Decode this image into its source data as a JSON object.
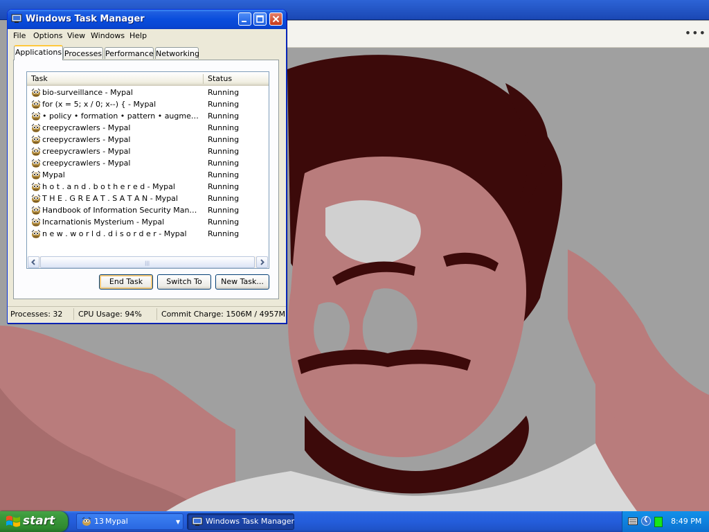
{
  "window": {
    "title": "Windows Task Manager",
    "icon": "task-manager-icon"
  },
  "menu": [
    "File",
    "Options",
    "View",
    "Windows",
    "Help"
  ],
  "tabs": [
    {
      "label": "Applications",
      "active": true
    },
    {
      "label": "Processes",
      "active": false
    },
    {
      "label": "Performance",
      "active": false
    },
    {
      "label": "Networking",
      "active": false
    }
  ],
  "list": {
    "columns": [
      "Task",
      "Status"
    ],
    "rows": [
      {
        "task": "bio-surveillance - Mypal",
        "status": "Running"
      },
      {
        "task": "for (x = 5; x / 0; x--) { - Mypal",
        "status": "Running"
      },
      {
        "task": "• policy • formation • pattern • augmentation • - Mypal",
        "status": "Running"
      },
      {
        "task": "creepycrawlers - Mypal",
        "status": "Running"
      },
      {
        "task": "creepycrawlers - Mypal",
        "status": "Running"
      },
      {
        "task": "creepycrawlers - Mypal",
        "status": "Running"
      },
      {
        "task": "creepycrawlers - Mypal",
        "status": "Running"
      },
      {
        "task": "Mypal",
        "status": "Running"
      },
      {
        "task": "h o t . a n d . b o t h e r e d - Mypal",
        "status": "Running"
      },
      {
        "task": "T H E . G R E A T . S A T A N - Mypal",
        "status": "Running"
      },
      {
        "task": "Handbook of Information Security Management - Mypal",
        "status": "Running"
      },
      {
        "task": "Incarnationis Mysterium - Mypal",
        "status": "Running"
      },
      {
        "task": "n e w . w o r l d . d i s o r d e r - Mypal",
        "status": "Running"
      }
    ],
    "row_icon": "mypal-icon"
  },
  "buttons": {
    "end_task": "End Task",
    "switch_to": "Switch To",
    "new_task": "New Task..."
  },
  "status": {
    "processes": "Processes: 32",
    "cpu": "CPU Usage: 94%",
    "commit": "Commit Charge: 1506M / 4957M"
  },
  "taskbar": {
    "start": "start",
    "mypal_count": "13",
    "mypal_label": "Mypal",
    "taskmgr_label": "Windows Task Manager",
    "clock": "8:49 PM"
  },
  "colors": {
    "wallpaper_dark": "#3c0a0a",
    "wallpaper_rose": "#b97c7c",
    "wallpaper_gray": "#a0a0a0",
    "wallpaper_light": "#d9d9d9",
    "xp_blue": "#0a4ddc",
    "start_green": "#3d9b3d"
  }
}
